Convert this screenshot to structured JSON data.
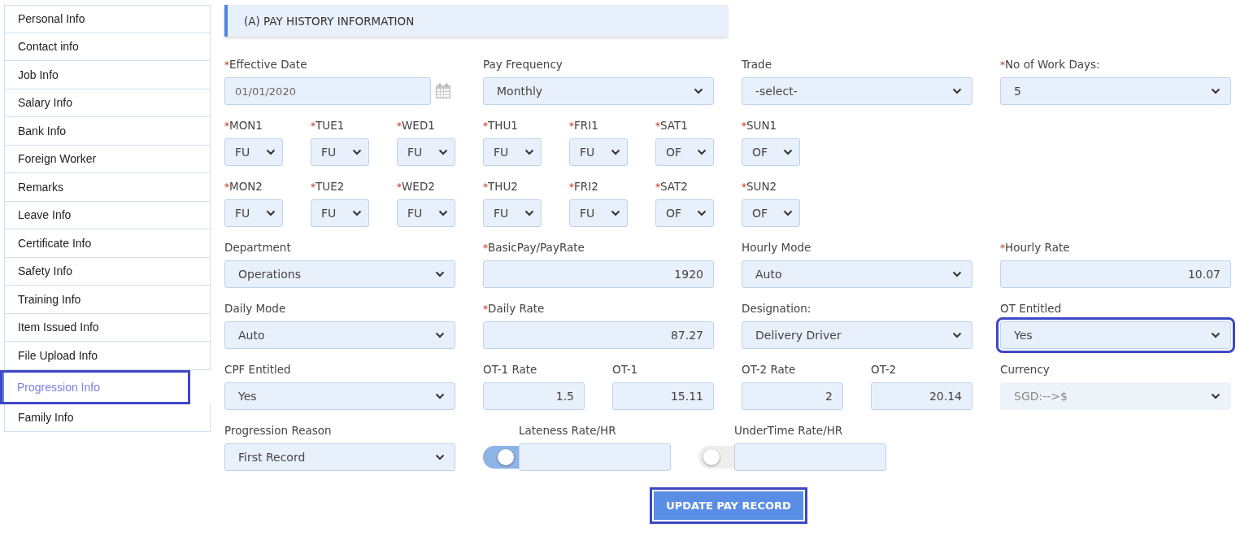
{
  "sidebar": {
    "items": [
      {
        "label": "Personal Info",
        "selected": false
      },
      {
        "label": "Contact info",
        "selected": false
      },
      {
        "label": "Job Info",
        "selected": false
      },
      {
        "label": "Salary Info",
        "selected": false
      },
      {
        "label": "Bank Info",
        "selected": false
      },
      {
        "label": "Foreign Worker",
        "selected": false
      },
      {
        "label": "Remarks",
        "selected": false
      },
      {
        "label": "Leave Info",
        "selected": false
      },
      {
        "label": "Certificate Info",
        "selected": false
      },
      {
        "label": "Safety Info",
        "selected": false
      },
      {
        "label": "Training Info",
        "selected": false
      },
      {
        "label": "Item Issued Info",
        "selected": false
      },
      {
        "label": "File Upload Info",
        "selected": false
      },
      {
        "label": "Progression Info",
        "selected": true
      },
      {
        "label": "Family Info",
        "selected": false
      }
    ]
  },
  "section_title": "(A) PAY HISTORY INFORMATION",
  "rows": [
    {
      "kind": "grid",
      "fields": [
        {
          "kind": "date",
          "required_mark": "*",
          "label": "Effective Date",
          "value": "01/01/2020"
        },
        {
          "kind": "select",
          "label": "Pay Frequency",
          "value": "Monthly"
        },
        {
          "kind": "select",
          "label": "Trade",
          "value": "-select-"
        },
        {
          "kind": "select",
          "required_mark": "*",
          "label": "No of Work Days:",
          "value": "5"
        }
      ]
    },
    {
      "kind": "days",
      "fields": [
        {
          "required_mark": "*",
          "label": "MON1",
          "value": "FU"
        },
        {
          "required_mark": "*",
          "label": "TUE1",
          "value": "FU"
        },
        {
          "required_mark": "*",
          "label": "WED1",
          "value": "FU"
        },
        {
          "required_mark": "*",
          "label": "THU1",
          "value": "FU"
        },
        {
          "required_mark": "*",
          "label": "FRI1",
          "value": "FU"
        },
        {
          "required_mark": "*",
          "label": "SAT1",
          "value": "OF"
        },
        {
          "required_mark": "*",
          "label": "SUN1",
          "value": "OF"
        }
      ]
    },
    {
      "kind": "days",
      "fields": [
        {
          "required_mark": "*",
          "label": "MON2",
          "value": "FU"
        },
        {
          "required_mark": "*",
          "label": "TUE2",
          "value": "FU"
        },
        {
          "required_mark": "*",
          "label": "WED2",
          "value": "FU"
        },
        {
          "required_mark": "*",
          "label": "THU2",
          "value": "FU"
        },
        {
          "required_mark": "*",
          "label": "FRI2",
          "value": "FU"
        },
        {
          "required_mark": "*",
          "label": "SAT2",
          "value": "OF"
        },
        {
          "required_mark": "*",
          "label": "SUN2",
          "value": "OF"
        }
      ]
    },
    {
      "kind": "grid",
      "fields": [
        {
          "kind": "select",
          "label": "Department",
          "value": "Operations"
        },
        {
          "kind": "text",
          "required_mark": "*",
          "label": "BasicPay/PayRate",
          "value": "1920"
        },
        {
          "kind": "select",
          "label": "Hourly Mode",
          "value": "Auto"
        },
        {
          "kind": "text",
          "required_mark": "*",
          "label": "Hourly Rate",
          "value": "10.07"
        }
      ]
    },
    {
      "kind": "grid",
      "fields": [
        {
          "kind": "select",
          "label": "Daily Mode",
          "value": "Auto"
        },
        {
          "kind": "text",
          "required_mark": "*",
          "label": "Daily Rate",
          "value": "87.27"
        },
        {
          "kind": "select",
          "label": "Designation:",
          "value": "Delivery Driver"
        },
        {
          "kind": "select",
          "label": "OT Entitled",
          "value": "Yes",
          "focused": true
        }
      ]
    },
    {
      "kind": "grid",
      "fields": [
        {
          "kind": "select",
          "label": "CPF Entitled",
          "value": "Yes"
        },
        {
          "kind": "short",
          "label": "OT-1 Rate",
          "value": "1.5"
        },
        {
          "kind": "short",
          "label": "OT-1",
          "value": "15.11"
        },
        {
          "kind": "short",
          "label": "OT-2 Rate",
          "value": "2"
        },
        {
          "kind": "short",
          "label": "OT-2",
          "value": "20.14"
        },
        {
          "kind": "select",
          "label": "Currency",
          "value": "SGD:-->$",
          "disabled": true
        }
      ]
    },
    {
      "kind": "toggles",
      "fields": [
        {
          "kind": "select",
          "label": "Progression Reason",
          "value": "First Record"
        },
        {
          "kind": "toggle",
          "label": "Lateness Rate/HR",
          "on": true
        },
        {
          "kind": "toggle",
          "label": "UnderTime Rate/HR",
          "on": false
        }
      ]
    }
  ],
  "button": {
    "label": "UPDATE PAY RECORD",
    "focused": true
  }
}
